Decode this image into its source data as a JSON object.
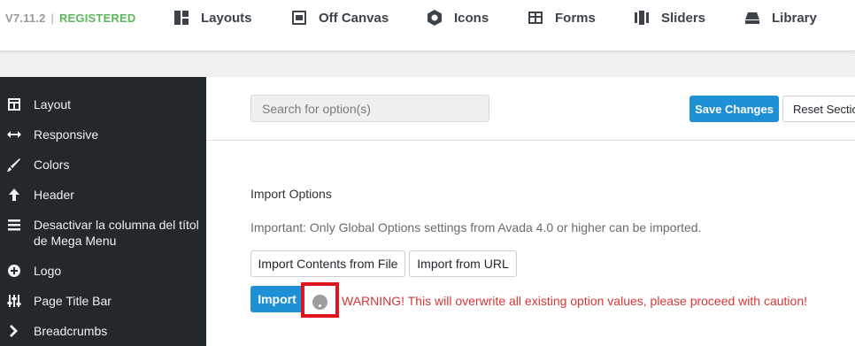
{
  "topbar": {
    "version": "V7.11.2",
    "separator": "|",
    "status": "REGISTERED",
    "nav": [
      {
        "label": "Layouts",
        "icon": "layouts-icon"
      },
      {
        "label": "Off Canvas",
        "icon": "off-canvas-icon"
      },
      {
        "label": "Icons",
        "icon": "icons-icon"
      },
      {
        "label": "Forms",
        "icon": "forms-icon"
      },
      {
        "label": "Sliders",
        "icon": "sliders-icon"
      },
      {
        "label": "Library",
        "icon": "library-icon"
      }
    ]
  },
  "sidebar": {
    "items": [
      {
        "label": "Layout",
        "icon": "layout-icon"
      },
      {
        "label": "Responsive",
        "icon": "arrows-horizontal-icon"
      },
      {
        "label": "Colors",
        "icon": "brush-icon"
      },
      {
        "label": "Header",
        "icon": "arrow-up-icon"
      },
      {
        "label": "Desactivar la columna del títol de Mega Menu",
        "icon": "menu-icon"
      },
      {
        "label": "Logo",
        "icon": "plus-circle-icon"
      },
      {
        "label": "Page Title Bar",
        "icon": "sliders-vertical-icon"
      },
      {
        "label": "Breadcrumbs",
        "icon": "chevron-right-icon"
      }
    ]
  },
  "main": {
    "search_placeholder": "Search for option(s)",
    "save_label": "Save Changes",
    "reset_label": "Reset Section",
    "section_title": "Import Options",
    "important_text": "Important: Only Global Options settings from Avada 4.0 or higher can be imported.",
    "import_file_label": "Import Contents from File",
    "import_url_label": "Import from URL",
    "import_label": "Import",
    "warning_text": "WARNING! This will overwrite all existing option values, please proceed with caution!"
  },
  "colors": {
    "accent": "#1f8fd6",
    "registered": "#5cb85c",
    "warning": "#d63638",
    "sidebar_bg": "#23282d",
    "highlight_box": "#e1141d"
  }
}
